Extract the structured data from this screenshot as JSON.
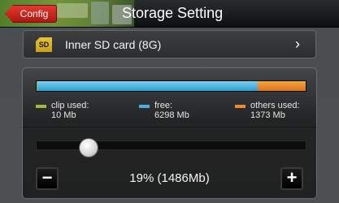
{
  "header": {
    "back_label": "Config",
    "title": "Storage Setting"
  },
  "storage": {
    "card_label": "Inner SD card (8G)",
    "sd_icon_text": "SD"
  },
  "usage": {
    "clip_used_mb": 10,
    "free_mb": 6298,
    "others_used_mb": 1373,
    "colors": {
      "clip": "#9bbd3a",
      "free": "#45b1e2",
      "others": "#e98c2d"
    },
    "legend": [
      {
        "label": "clip used:",
        "value": "10 Mb",
        "color": "#9bbd3a"
      },
      {
        "label": "free:",
        "value": "6298 Mb",
        "color": "#45b1e2"
      },
      {
        "label": "others used:",
        "value": "1373 Mb",
        "color": "#e98c2d"
      }
    ]
  },
  "allocation": {
    "percent_text": "19% (1486Mb)",
    "slider_fraction": 0.19,
    "minus_label": "−",
    "plus_label": "+"
  }
}
